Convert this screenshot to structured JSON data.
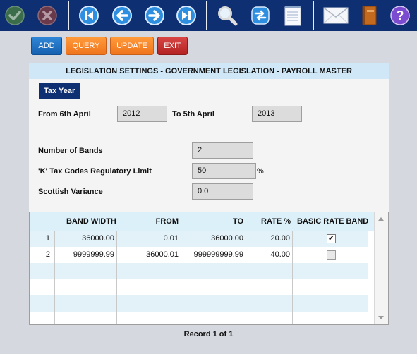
{
  "toolbar": {
    "icons": [
      "confirm-icon",
      "cancel-icon",
      "first-record-icon",
      "previous-record-icon",
      "next-record-icon",
      "last-record-icon",
      "search-icon",
      "refresh-icon",
      "notepad-icon",
      "mail-icon",
      "book-icon",
      "help-icon"
    ]
  },
  "actions": {
    "add": "ADD",
    "query": "QUERY",
    "update": "UPDATE",
    "exit": "EXIT"
  },
  "panel": {
    "title": "LEGISLATION SETTINGS - GOVERNMENT LEGISLATION - PAYROLL MASTER",
    "tab_label": "Tax Year",
    "from_label": "From 6th April",
    "from_value": "2012",
    "to_label": "To 5th April",
    "to_value": "2013",
    "bands_label": "Number of Bands",
    "bands_value": "2",
    "k_limit_label": "'K' Tax Codes Regulatory Limit",
    "k_limit_value": "50",
    "k_limit_unit": "%",
    "scottish_label": "Scottish Variance",
    "scottish_value": "0.0"
  },
  "grid": {
    "headers": [
      "BAND WIDTH",
      "FROM",
      "TO",
      "RATE %",
      "BASIC RATE BAND"
    ],
    "rows": [
      {
        "num": "1",
        "band_width": "36000.00",
        "from": "0.01",
        "to": "36000.00",
        "rate": "20.00",
        "basic_rate_band": true
      },
      {
        "num": "2",
        "band_width": "9999999.99",
        "from": "36000.01",
        "to": "999999999.99",
        "rate": "40.00",
        "basic_rate_band": false
      }
    ]
  },
  "status": {
    "record": "Record 1 of 1"
  },
  "colors": {
    "toolbar": "#0f2f73",
    "panel_title_bg": "#cfe7f6",
    "grid_alt_row": "#e3f2f9",
    "button_blue": "#1f74c5",
    "button_orange": "#f5822a",
    "button_red": "#c23030"
  }
}
